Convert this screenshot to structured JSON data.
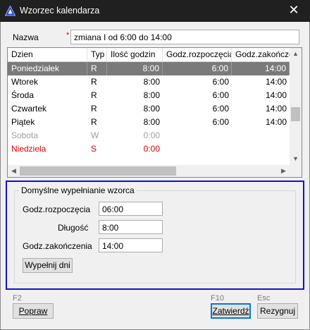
{
  "window": {
    "title": "Wzorzec kalendarza",
    "close_glyph": "✕"
  },
  "form": {
    "name_label": "Nazwa",
    "required_mark": "*",
    "name_value": "zmiana I od 6:00 do 14:00"
  },
  "grid": {
    "columns": [
      "Dzien",
      "Typ",
      "Ilość godzin",
      "Godz.rozpoczęcia",
      "Godz.zakończeni"
    ],
    "rows": [
      {
        "day": "Poniedziałek",
        "type": "R",
        "hours": "8:00",
        "start": "6:00",
        "end": "14:00",
        "state": "selected"
      },
      {
        "day": "Wtorek",
        "type": "R",
        "hours": "8:00",
        "start": "6:00",
        "end": "14:00",
        "state": "normal"
      },
      {
        "day": "Środa",
        "type": "R",
        "hours": "8:00",
        "start": "6:00",
        "end": "14:00",
        "state": "normal"
      },
      {
        "day": "Czwartek",
        "type": "R",
        "hours": "8:00",
        "start": "6:00",
        "end": "14:00",
        "state": "normal"
      },
      {
        "day": "Piątek",
        "type": "R",
        "hours": "8:00",
        "start": "6:00",
        "end": "14:00",
        "state": "normal"
      },
      {
        "day": "Sobota",
        "type": "W",
        "hours": "0:00",
        "start": "",
        "end": "",
        "state": "free"
      },
      {
        "day": "Niedziela",
        "type": "S",
        "hours": "0:00",
        "start": "",
        "end": "",
        "state": "holiday"
      }
    ]
  },
  "defaults": {
    "group_title": "Domyślne wypełnianie wzorca",
    "start_label": "Godz.rozpoczęcia",
    "start_value": "06:00",
    "length_label": "Długość",
    "length_value": "8:00",
    "end_label": "Godz.zakończenia",
    "end_value": "14:00",
    "fill_button": "Wypełnij dni"
  },
  "footer": {
    "f2_hint": "F2",
    "correct_button": "Popraw",
    "f10_hint": "F10",
    "confirm_button": "Zatwierdź",
    "esc_hint": "Esc",
    "cancel_button": "Rezygnuj"
  },
  "colors": {
    "selected_row": "#7a7a7a",
    "free_day": "#a0a0a0",
    "holiday": "#e00000",
    "focus_frame": "#1010d0"
  }
}
